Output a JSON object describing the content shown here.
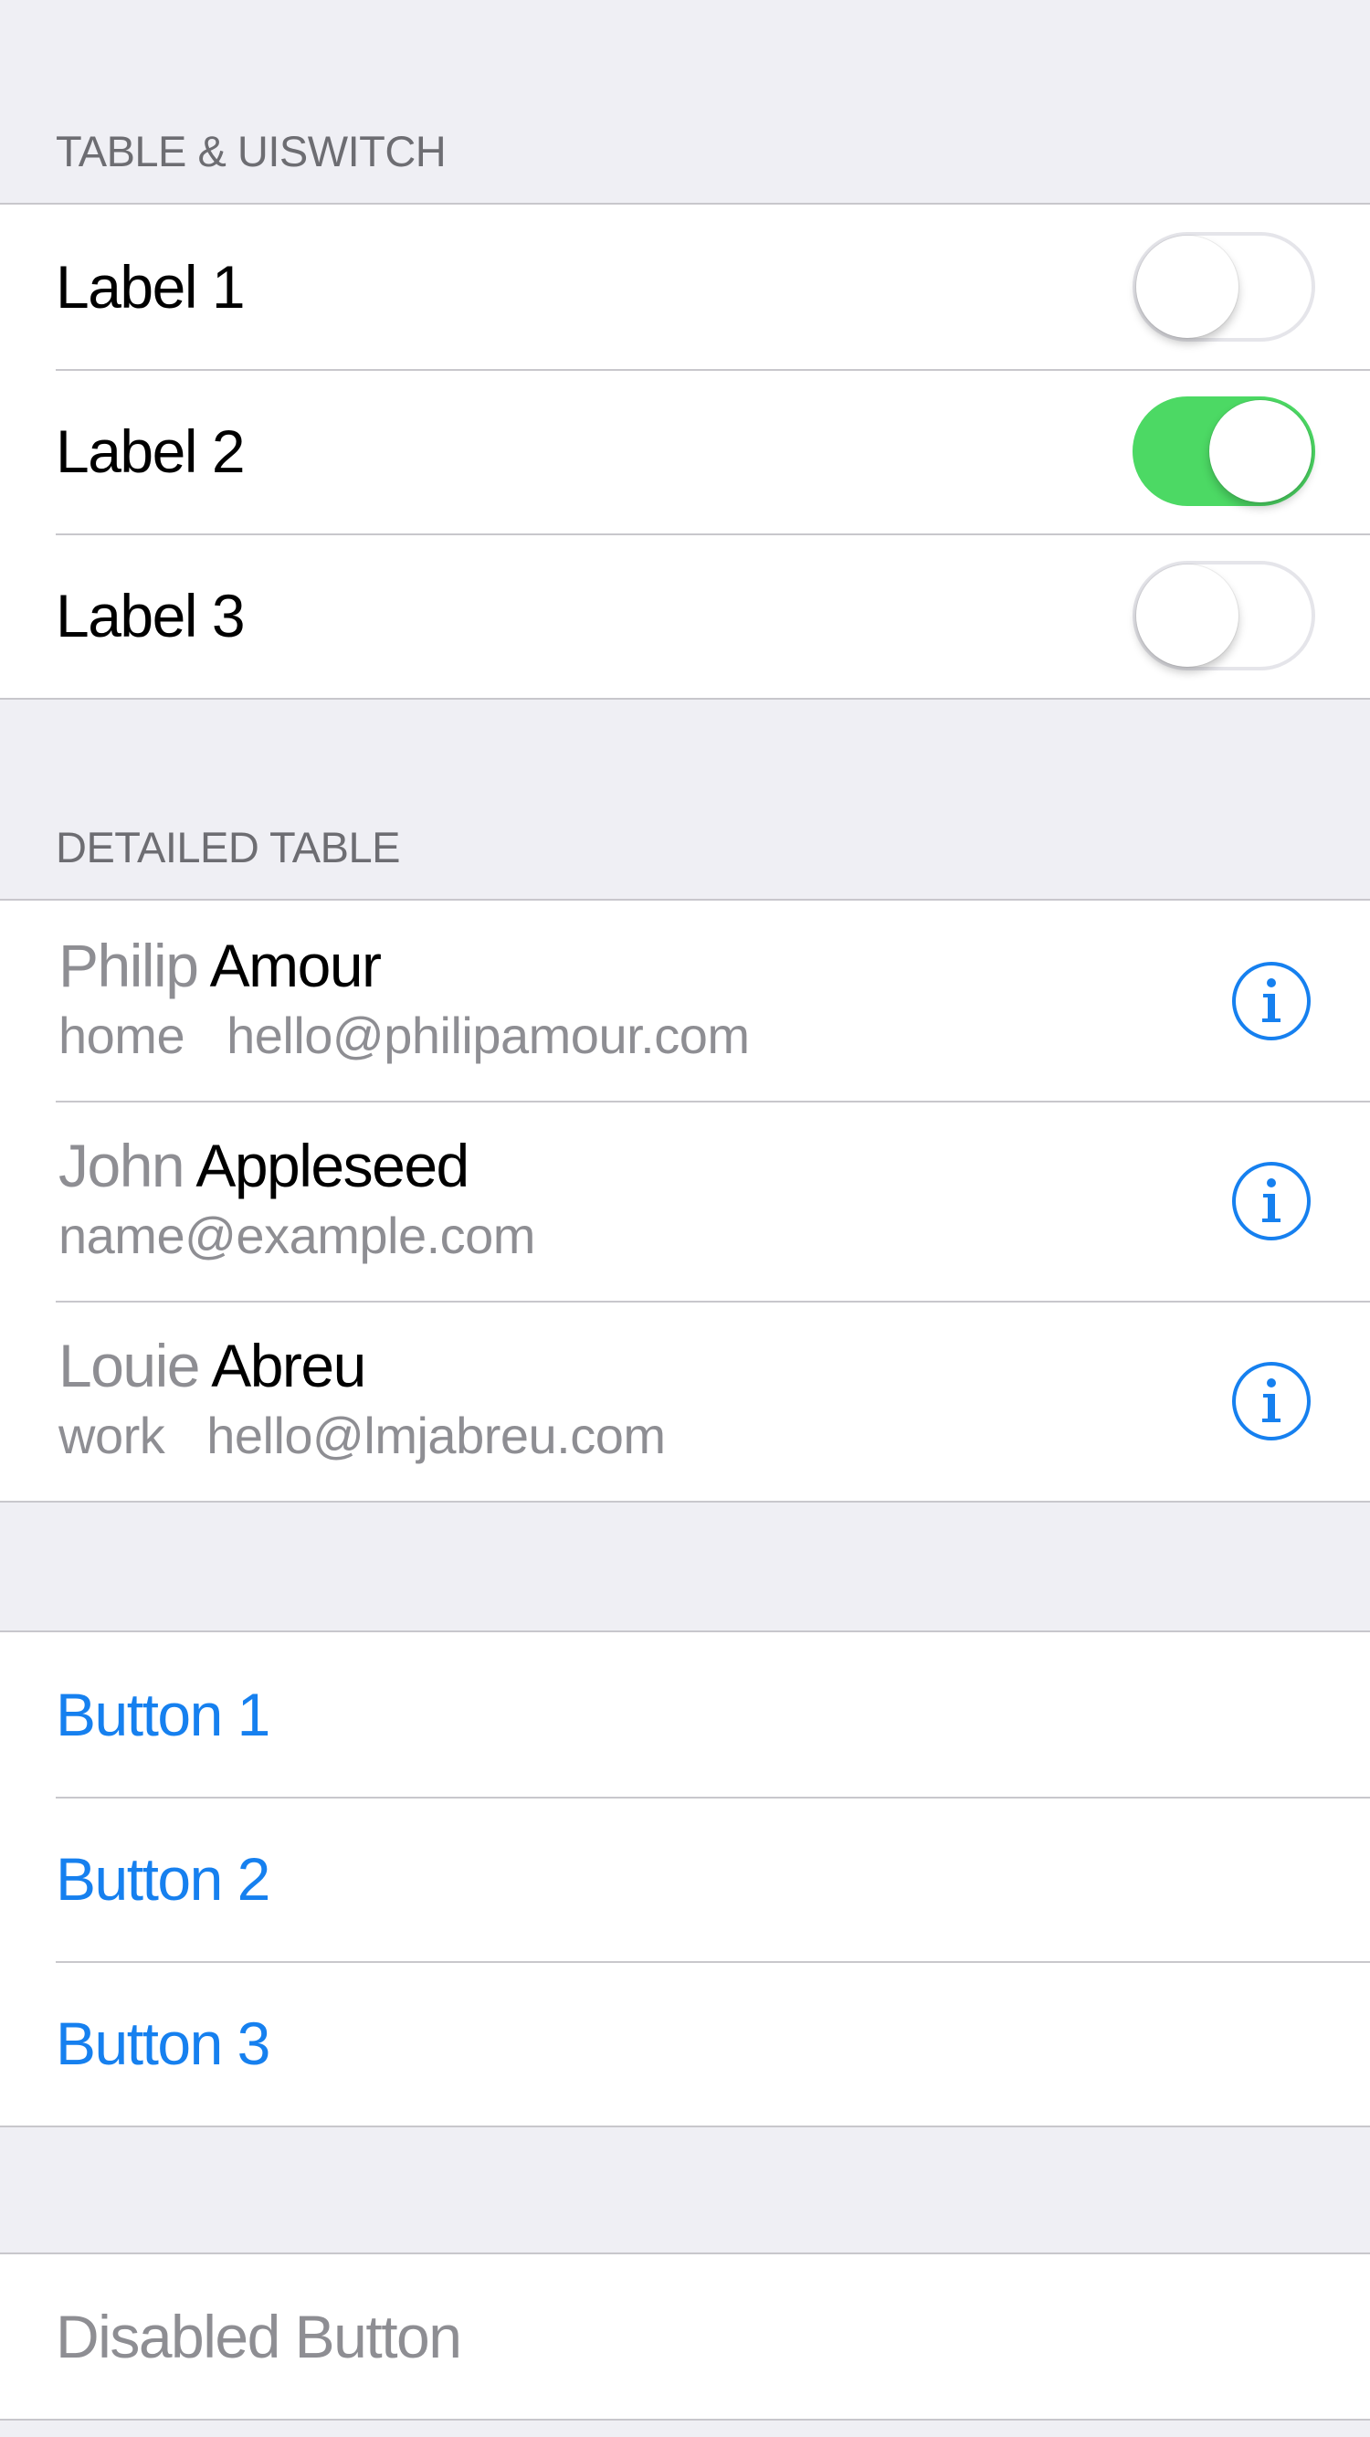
{
  "switch_section": {
    "header": "TABLE & UISWITCH",
    "rows": [
      {
        "label": "Label 1",
        "on": false
      },
      {
        "label": "Label 2",
        "on": true
      },
      {
        "label": "Label 3",
        "on": false
      }
    ]
  },
  "detail_section": {
    "header": "DETAILED TABLE",
    "contacts": [
      {
        "first": "Philip",
        "last": "Amour",
        "kind": "home",
        "email": "hello@philipamour.com"
      },
      {
        "first": "John",
        "last": "Appleseed",
        "kind": "",
        "email": "name@example.com"
      },
      {
        "first": "Louie",
        "last": "Abreu",
        "kind": "work",
        "email": "hello@lmjabreu.com"
      }
    ]
  },
  "button_section": {
    "buttons": [
      "Button 1",
      "Button 2",
      "Button 3"
    ]
  },
  "disabled_section": {
    "button": "Disabled Button"
  },
  "colors": {
    "background": "#efeff4",
    "tint": "#1680ef",
    "switch_on": "#4cd964",
    "secondary_text": "#8e8e93",
    "separator": "#c8c7cc"
  },
  "icons": {
    "info": "info-circle-icon"
  }
}
